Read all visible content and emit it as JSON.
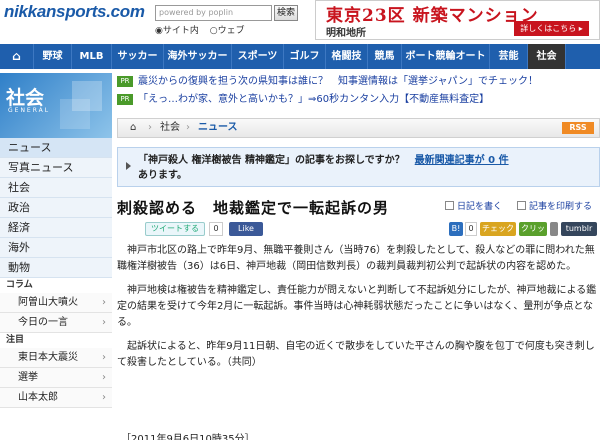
{
  "header": {
    "logo": "nikkansports.com",
    "search_placeholder": "powered by poplin",
    "search_button": "検索",
    "radio_site": "◉サイト内",
    "radio_web": "○ウェブ",
    "ad_title": "東京23区 新築マンション",
    "ad_company": "明和地所",
    "ad_button": "詳しくはこちら ▸"
  },
  "nav": {
    "items": [
      {
        "label": "⌂"
      },
      {
        "label": "野球"
      },
      {
        "label": "MLB"
      },
      {
        "label": "サッカー"
      },
      {
        "label": "海外サッカー"
      },
      {
        "label": "スポーツ"
      },
      {
        "label": "ゴルフ"
      },
      {
        "label": "格闘技"
      },
      {
        "label": "競馬"
      },
      {
        "label": "ボート競輪オート"
      },
      {
        "label": "芸能"
      },
      {
        "label": "社会"
      }
    ],
    "active_color": "#333333",
    "bar_color": "#1f5fad"
  },
  "sidebar": {
    "title": "社会",
    "subtitle": "GENERAL",
    "items": [
      "ニュース",
      "写真ニュース",
      "社会",
      "政治",
      "経済",
      "海外",
      "動物"
    ],
    "column_head": "コラム",
    "columns": [
      "阿曽山大噴火",
      "今日の一言"
    ],
    "attention_head": "注目",
    "attention": [
      "東日本大震災",
      "選挙",
      "山本太郎"
    ]
  },
  "pr": [
    {
      "badge": "PR",
      "text": "震災からの復興を担う次の県知事は誰に？　知事選情報は「選挙ジャパン」でチェック！"
    },
    {
      "badge": "PR",
      "text": "「えっ…わが家、意外と高いかも？」⇒60秒カンタン入力【不動産無料査定】"
    }
  ],
  "breadcrumb": {
    "home": "⌂",
    "section": "社会",
    "current": "ニュース",
    "rss": "RSS"
  },
  "notice": {
    "text_line1_a": "「神戸殺人 権洋樹被告 精神鑑定」の記事をお探しですか？　",
    "text_line1_b": "最新関連記事が 0 件",
    "text_line2": "あります。"
  },
  "article": {
    "title": "刺殺認める　地裁鑑定で一転起訴の男",
    "diary_link": "日記を書く",
    "print_link": "記事を印刷する",
    "tweet_button": "ツイートする",
    "tweet_count": "0",
    "like_button": "Like",
    "hatena_count": "0",
    "mixi_label": "チェック",
    "clip_label": "クリップ",
    "tumblr_label": "tumblr",
    "paragraphs": [
      "神戸市北区の路上で昨年9月、無職平養則さん（当時76）を刺殺したとして、殺人などの罪に問われた無職権洋樹被告（36）は6日、神戸地裁（岡田信数判長）の裁判員裁判初公判で起訴状の内容を認めた。",
      "神戸地検は権被告を精神鑑定し、責任能力が問えないと判断して不起訴処分にしたが、神戸地裁による鑑定の結果を受けて今年2月に一転起訴。事件当時は心神耗弱状態だったことに争いはなく、量刑が争点となる。",
      "起訴状によると、昨年9月11日朝、自宅の近くで散歩をしていた平さんの胸や腹を包丁で何度も突き刺して殺害したとしている。（共同）"
    ],
    "dateline": "［2011年9月6日10時35分］"
  }
}
